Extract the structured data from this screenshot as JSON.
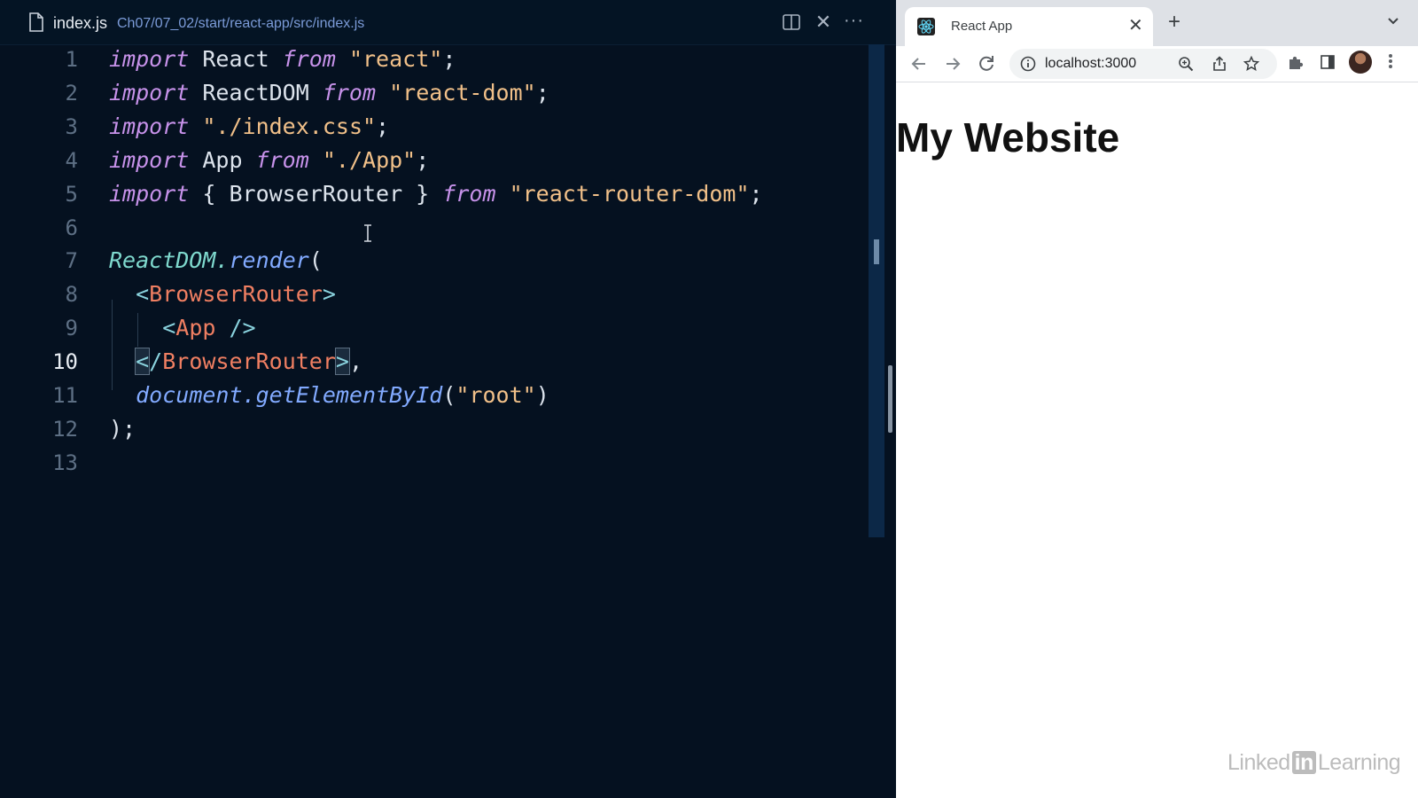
{
  "editor": {
    "file_name": "index.js",
    "file_path": "Ch07/07_02/start/react-app/src/index.js",
    "toolbar": {
      "close_glyph": "✕",
      "more_glyph": "···"
    },
    "lines": [
      {
        "no": "1",
        "tokens": [
          [
            "kw",
            "import"
          ],
          [
            "id",
            " React "
          ],
          [
            "kw",
            "from"
          ],
          [
            "id",
            " "
          ],
          [
            "str",
            "\"react\""
          ],
          [
            "punc",
            ";"
          ]
        ]
      },
      {
        "no": "2",
        "tokens": [
          [
            "kw",
            "import"
          ],
          [
            "id",
            " ReactDOM "
          ],
          [
            "kw",
            "from"
          ],
          [
            "id",
            " "
          ],
          [
            "str",
            "\"react-dom\""
          ],
          [
            "punc",
            ";"
          ]
        ]
      },
      {
        "no": "3",
        "tokens": [
          [
            "kw",
            "import"
          ],
          [
            "id",
            " "
          ],
          [
            "str",
            "\"./index.css\""
          ],
          [
            "punc",
            ";"
          ]
        ]
      },
      {
        "no": "4",
        "tokens": [
          [
            "kw",
            "import"
          ],
          [
            "id",
            " App "
          ],
          [
            "kw",
            "from"
          ],
          [
            "id",
            " "
          ],
          [
            "str",
            "\"./App\""
          ],
          [
            "punc",
            ";"
          ]
        ]
      },
      {
        "no": "5",
        "tokens": [
          [
            "kw",
            "import"
          ],
          [
            "id",
            " { BrowserRouter } "
          ],
          [
            "kw",
            "from"
          ],
          [
            "id",
            " "
          ],
          [
            "str",
            "\"react-router-dom\""
          ],
          [
            "punc",
            ";"
          ]
        ]
      },
      {
        "no": "6",
        "tokens": []
      },
      {
        "no": "7",
        "tokens": [
          [
            "fn",
            "ReactDOM"
          ],
          [
            "fn",
            "."
          ],
          [
            "fnb",
            "render"
          ],
          [
            "punc",
            "("
          ]
        ]
      },
      {
        "no": "8",
        "tokens": [
          [
            "id",
            "  "
          ],
          [
            "tagc",
            "<"
          ],
          [
            "tagn",
            "BrowserRouter"
          ],
          [
            "tagc",
            ">"
          ]
        ]
      },
      {
        "no": "9",
        "tokens": [
          [
            "id",
            "    "
          ],
          [
            "tagc",
            "<"
          ],
          [
            "tagn",
            "App"
          ],
          [
            "tagc",
            " />"
          ]
        ]
      },
      {
        "no": "10",
        "active": true,
        "tokens": [
          [
            "id",
            "  "
          ],
          [
            "tagc hl",
            "<"
          ],
          [
            "tagc",
            "/"
          ],
          [
            "tagn",
            "BrowserRouter"
          ],
          [
            "tagc hl",
            ">"
          ],
          [
            "punc",
            ","
          ]
        ]
      },
      {
        "no": "11",
        "tokens": [
          [
            "id",
            "  "
          ],
          [
            "fnb",
            "document"
          ],
          [
            "fnb",
            "."
          ],
          [
            "fnb",
            "getElementById"
          ],
          [
            "punc",
            "("
          ],
          [
            "str",
            "\"root\""
          ],
          [
            "punc",
            ")"
          ]
        ]
      },
      {
        "no": "12",
        "tokens": [
          [
            "punc",
            ");"
          ]
        ]
      },
      {
        "no": "13",
        "tokens": []
      }
    ]
  },
  "browser": {
    "tab_title": "React App",
    "tab_close": "✕",
    "new_tab": "+",
    "url": "localhost:3000",
    "page_heading": "My Website"
  },
  "watermark": {
    "part1": "Linked",
    "part2": "in",
    "part3": "Learning"
  },
  "colors": {
    "editor_bg": "#051120",
    "keyword": "#c792ea",
    "string": "#f1c089",
    "tag_name": "#f07f62",
    "function": "#82aaff"
  }
}
